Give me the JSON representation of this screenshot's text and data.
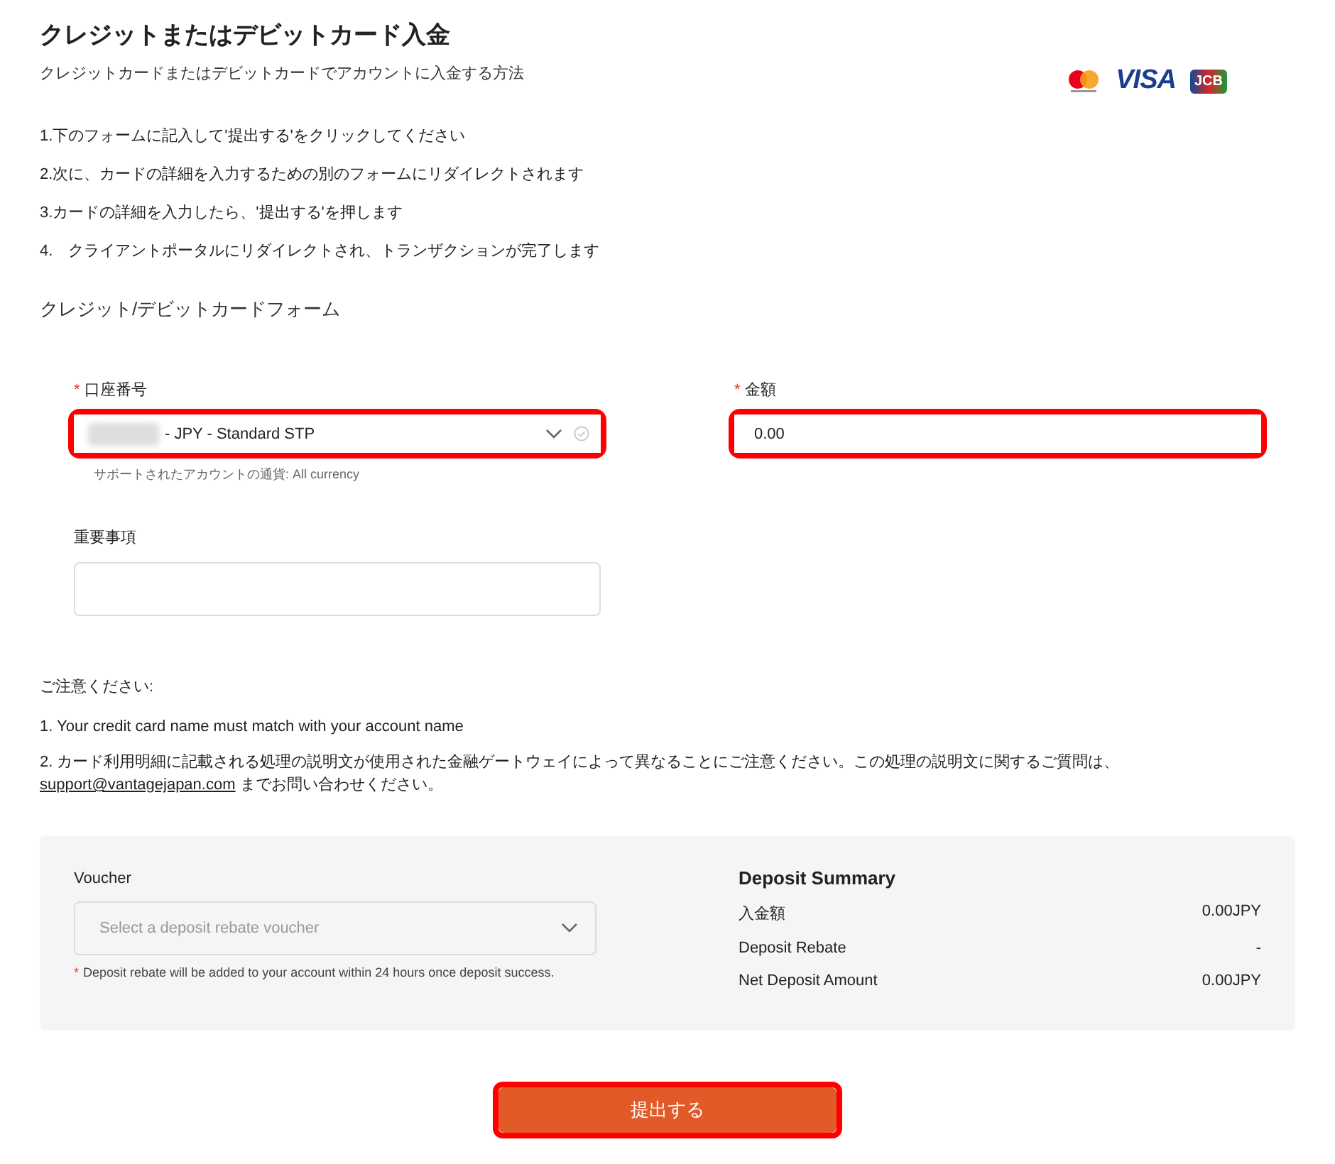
{
  "header": {
    "title": "クレジットまたはデビットカード入金",
    "subtitle": "クレジットカードまたはデビットカードでアカウントに入金する方法",
    "card_logos": [
      {
        "kind": "mastercard"
      },
      {
        "kind": "visa",
        "text": "VISA"
      },
      {
        "kind": "jcb",
        "text": "JCB"
      }
    ]
  },
  "steps": [
    "1.下のフォームに記入して'提出する'をクリックしてください",
    "2.次に、カードの詳細を入力するための別のフォームにリダイレクトされます",
    "3.カードの詳細を入力したら、'提出する'を押します",
    "4.　クライアントポータルにリダイレクトされ、トランザクションが完了します"
  ],
  "form": {
    "title": "クレジット/デビットカードフォーム",
    "account": {
      "label": "口座番号",
      "required_mark": "*",
      "redacted": true,
      "value": "- JPY - Standard STP",
      "highlighted": true,
      "hint": "サポートされたアカウントの通貨: All currency"
    },
    "amount": {
      "label": "金額",
      "required_mark": "*",
      "value": "0.00",
      "highlighted": true
    },
    "notes_field": {
      "label": "重要事項"
    }
  },
  "notice": {
    "title": "ご注意ください:",
    "line1": "1. Your credit card name must match with your account name",
    "line2_before": "2. カード利用明細に記載される処理の説明文が使用された金融ゲートウェイによって異なることにご注意ください。この処理の説明文に関するご質問は、",
    "link": "support@vantagejapan.com",
    "line2_after": " までお問い合わせください。"
  },
  "voucher": {
    "label": "Voucher",
    "placeholder": "Select a deposit rebate voucher",
    "hint_mark": "*",
    "hint": "Deposit rebate will be added to your account within 24 hours once deposit success."
  },
  "summary": {
    "title": "Deposit Summary",
    "rows": [
      {
        "label": "入金額",
        "value": "0.00JPY"
      },
      {
        "label": "Deposit Rebate",
        "value": "-"
      },
      {
        "label": "Net Deposit Amount",
        "value": "0.00JPY"
      }
    ]
  },
  "submit": {
    "label": "提出する",
    "highlighted": true
  }
}
